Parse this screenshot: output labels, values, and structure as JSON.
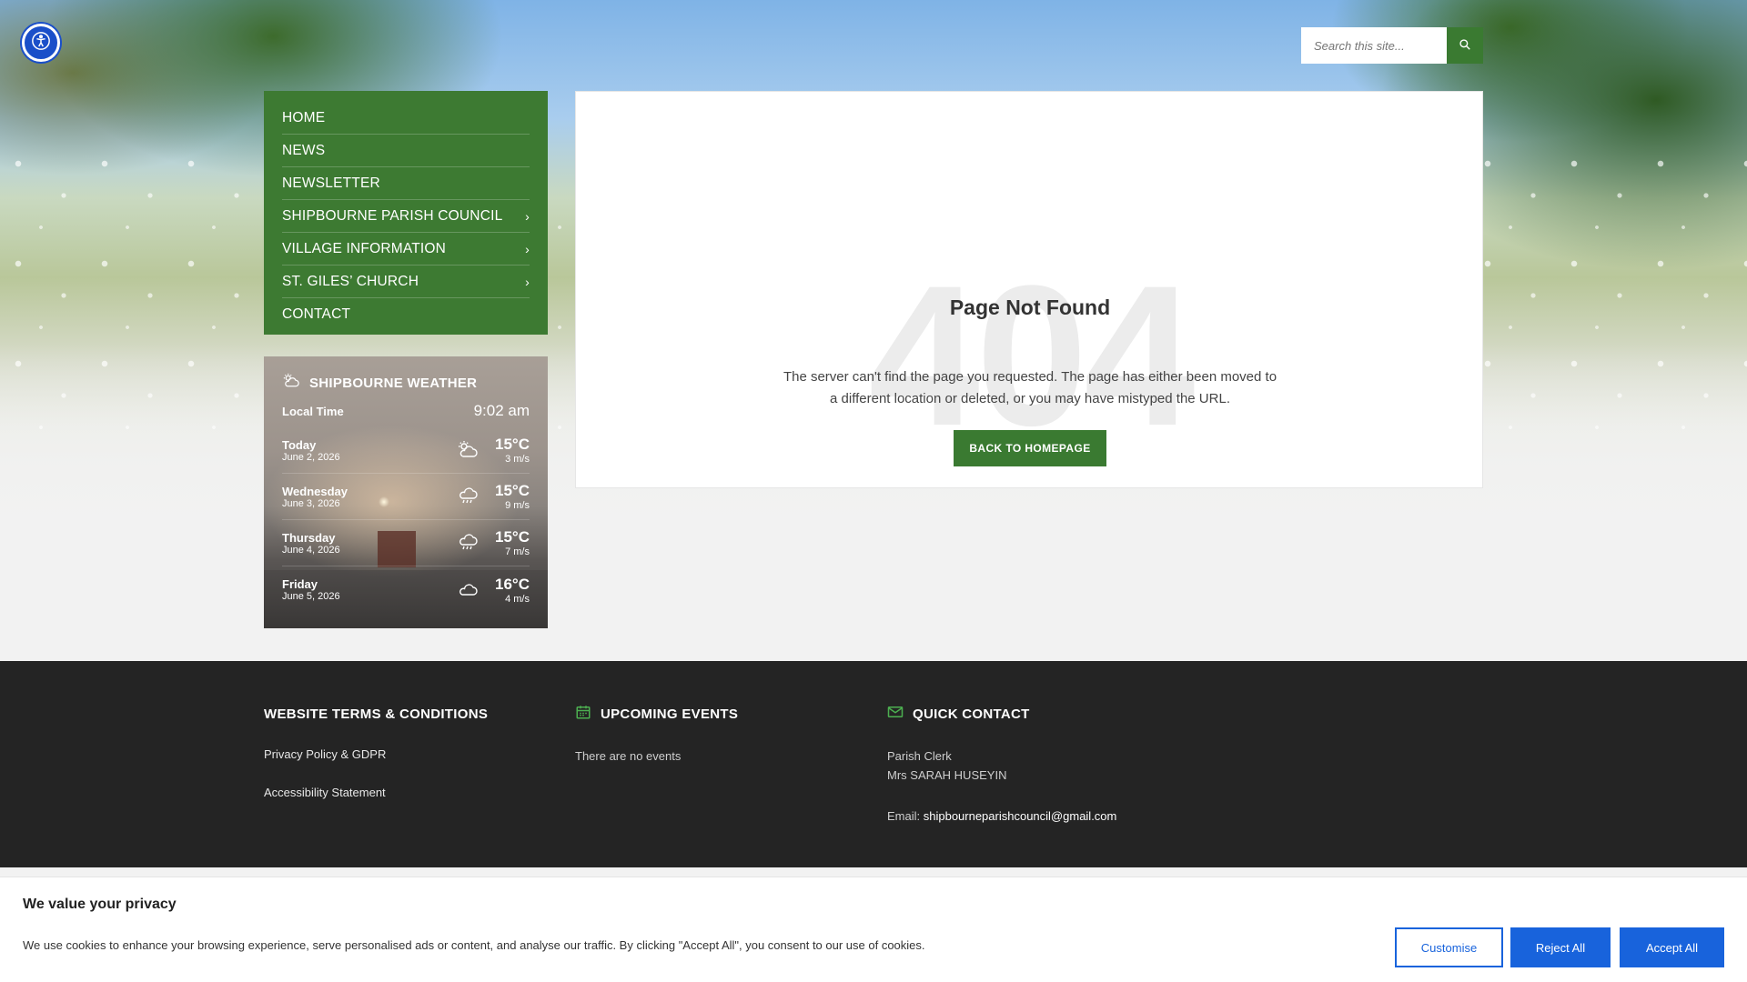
{
  "accessibility": {
    "icon": "accessibility-icon"
  },
  "search": {
    "placeholder": "Search this site...",
    "icon": "search-icon"
  },
  "nav": {
    "items": [
      {
        "label": "HOME",
        "has_submenu": false
      },
      {
        "label": "NEWS",
        "has_submenu": false
      },
      {
        "label": "NEWSLETTER",
        "has_submenu": false
      },
      {
        "label": "SHIPBOURNE PARISH COUNCIL",
        "has_submenu": true
      },
      {
        "label": "VILLAGE INFORMATION",
        "has_submenu": true
      },
      {
        "label": "ST. GILES’ CHURCH",
        "has_submenu": true
      },
      {
        "label": "CONTACT",
        "has_submenu": false
      }
    ],
    "chevron": "›"
  },
  "weather": {
    "title": "SHIPBOURNE WEATHER",
    "local_time_label": "Local Time",
    "local_time": "9:02 am",
    "days": [
      {
        "day": "Today",
        "date": "June 2, 2026",
        "icon": "partly-cloudy-icon",
        "temp": "15°C",
        "wind": "3 m/s"
      },
      {
        "day": "Wednesday",
        "date": "June 3, 2026",
        "icon": "rain-icon",
        "temp": "15°C",
        "wind": "9 m/s"
      },
      {
        "day": "Thursday",
        "date": "June 4, 2026",
        "icon": "rain-icon",
        "temp": "15°C",
        "wind": "7 m/s"
      },
      {
        "day": "Friday",
        "date": "June 5, 2026",
        "icon": "cloud-icon",
        "temp": "16°C",
        "wind": "4 m/s"
      }
    ]
  },
  "error": {
    "code": "404",
    "title": "Page Not Found",
    "description": "The server can't find the page you requested. The page has either been moved to a different location or deleted, or you may have mistyped the URL.",
    "button": "BACK TO HOMEPAGE"
  },
  "footer": {
    "terms": {
      "heading": "WEBSITE TERMS & CONDITIONS",
      "links": [
        "Privacy Policy & GDPR",
        "Accessibility Statement"
      ]
    },
    "events": {
      "heading": "UPCOMING EVENTS",
      "icon": "calendar-icon",
      "text": "There are no events"
    },
    "contact": {
      "heading": "QUICK CONTACT",
      "icon": "envelope-icon",
      "role": "Parish Clerk",
      "name": "Mrs SARAH HUSEYIN",
      "email_label": "Email: ",
      "email": "shipbourneparishcouncil@gmail.com"
    }
  },
  "cookie": {
    "title": "We value your privacy",
    "text": "We use cookies to enhance your browsing experience, serve personalised ads or content, and analyse our traffic. By clicking \"Accept All\", you consent to our use of cookies.",
    "customise": "Customise",
    "reject": "Reject All",
    "accept": "Accept All"
  },
  "colors": {
    "primary_green": "#3a7a31",
    "footer_bg": "#242424",
    "cookie_blue": "#1863dc",
    "a11y_blue": "#1a4fc9"
  }
}
